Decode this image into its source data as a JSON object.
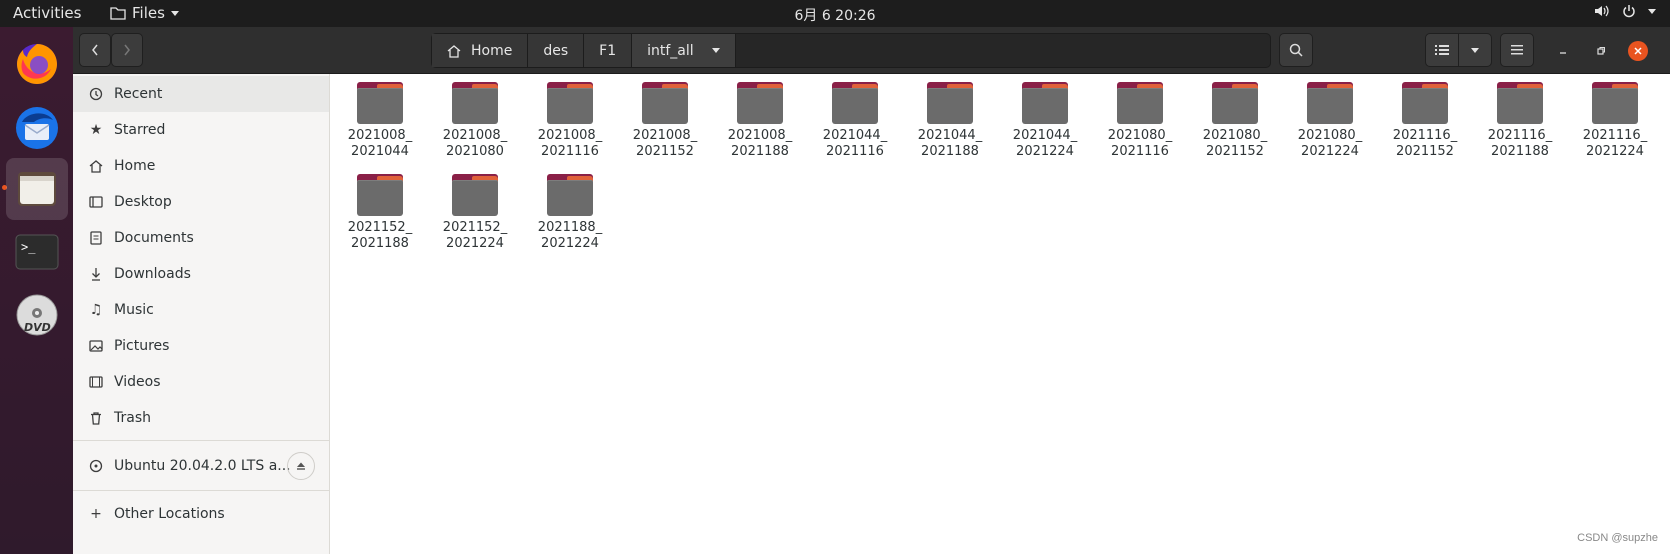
{
  "topbar": {
    "activities": "Activities",
    "app_menu": "Files",
    "clock": "6月 6  20:26"
  },
  "dock": {
    "items": [
      {
        "name": "firefox-icon"
      },
      {
        "name": "thunderbird-icon"
      },
      {
        "name": "files-icon",
        "active": true
      },
      {
        "name": "terminal-icon"
      },
      {
        "name": "dvd-icon"
      }
    ]
  },
  "pathbar": {
    "crumbs": [
      "Home",
      "des",
      "F1",
      "intf_all"
    ]
  },
  "sidebar": {
    "items": [
      {
        "label": "Recent",
        "icon": "clock-icon"
      },
      {
        "label": "Starred",
        "icon": "star-icon"
      },
      {
        "label": "Home",
        "icon": "home-icon"
      },
      {
        "label": "Desktop",
        "icon": "desktop-icon"
      },
      {
        "label": "Documents",
        "icon": "documents-icon"
      },
      {
        "label": "Downloads",
        "icon": "downloads-icon"
      },
      {
        "label": "Music",
        "icon": "music-icon"
      },
      {
        "label": "Pictures",
        "icon": "pictures-icon"
      },
      {
        "label": "Videos",
        "icon": "videos-icon"
      },
      {
        "label": "Trash",
        "icon": "trash-icon"
      }
    ],
    "device": "Ubuntu 20.04.2.0 LTS a...",
    "other_locations": "Other Locations"
  },
  "files": [
    {
      "line1": "2021008_",
      "line2": "2021044"
    },
    {
      "line1": "2021008_",
      "line2": "2021080"
    },
    {
      "line1": "2021008_",
      "line2": "2021116"
    },
    {
      "line1": "2021008_",
      "line2": "2021152"
    },
    {
      "line1": "2021008_",
      "line2": "2021188"
    },
    {
      "line1": "2021044_",
      "line2": "2021116"
    },
    {
      "line1": "2021044_",
      "line2": "2021188"
    },
    {
      "line1": "2021044_",
      "line2": "2021224"
    },
    {
      "line1": "2021080_",
      "line2": "2021116"
    },
    {
      "line1": "2021080_",
      "line2": "2021152"
    },
    {
      "line1": "2021080_",
      "line2": "2021224"
    },
    {
      "line1": "2021116_",
      "line2": "2021152"
    },
    {
      "line1": "2021116_",
      "line2": "2021188"
    },
    {
      "line1": "2021116_",
      "line2": "2021224"
    },
    {
      "line1": "2021152_",
      "line2": "2021188"
    },
    {
      "line1": "2021152_",
      "line2": "2021224"
    },
    {
      "line1": "2021188_",
      "line2": "2021224"
    }
  ],
  "watermark": "CSDN @supzhe"
}
